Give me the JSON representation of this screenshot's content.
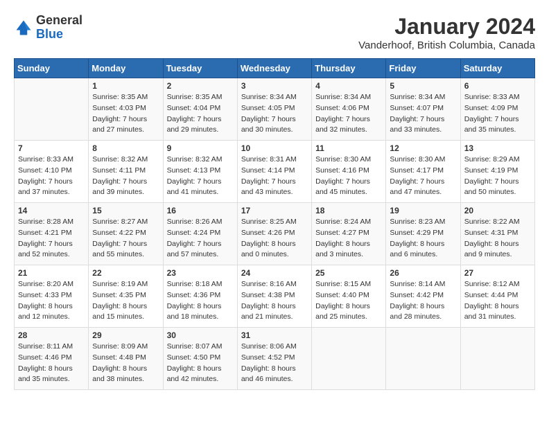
{
  "logo": {
    "general": "General",
    "blue": "Blue"
  },
  "title": "January 2024",
  "subtitle": "Vanderhoof, British Columbia, Canada",
  "headers": [
    "Sunday",
    "Monday",
    "Tuesday",
    "Wednesday",
    "Thursday",
    "Friday",
    "Saturday"
  ],
  "weeks": [
    [
      {
        "num": "",
        "sunrise": "",
        "sunset": "",
        "daylight": ""
      },
      {
        "num": "1",
        "sunrise": "Sunrise: 8:35 AM",
        "sunset": "Sunset: 4:03 PM",
        "daylight": "Daylight: 7 hours and 27 minutes."
      },
      {
        "num": "2",
        "sunrise": "Sunrise: 8:35 AM",
        "sunset": "Sunset: 4:04 PM",
        "daylight": "Daylight: 7 hours and 29 minutes."
      },
      {
        "num": "3",
        "sunrise": "Sunrise: 8:34 AM",
        "sunset": "Sunset: 4:05 PM",
        "daylight": "Daylight: 7 hours and 30 minutes."
      },
      {
        "num": "4",
        "sunrise": "Sunrise: 8:34 AM",
        "sunset": "Sunset: 4:06 PM",
        "daylight": "Daylight: 7 hours and 32 minutes."
      },
      {
        "num": "5",
        "sunrise": "Sunrise: 8:34 AM",
        "sunset": "Sunset: 4:07 PM",
        "daylight": "Daylight: 7 hours and 33 minutes."
      },
      {
        "num": "6",
        "sunrise": "Sunrise: 8:33 AM",
        "sunset": "Sunset: 4:09 PM",
        "daylight": "Daylight: 7 hours and 35 minutes."
      }
    ],
    [
      {
        "num": "7",
        "sunrise": "Sunrise: 8:33 AM",
        "sunset": "Sunset: 4:10 PM",
        "daylight": "Daylight: 7 hours and 37 minutes."
      },
      {
        "num": "8",
        "sunrise": "Sunrise: 8:32 AM",
        "sunset": "Sunset: 4:11 PM",
        "daylight": "Daylight: 7 hours and 39 minutes."
      },
      {
        "num": "9",
        "sunrise": "Sunrise: 8:32 AM",
        "sunset": "Sunset: 4:13 PM",
        "daylight": "Daylight: 7 hours and 41 minutes."
      },
      {
        "num": "10",
        "sunrise": "Sunrise: 8:31 AM",
        "sunset": "Sunset: 4:14 PM",
        "daylight": "Daylight: 7 hours and 43 minutes."
      },
      {
        "num": "11",
        "sunrise": "Sunrise: 8:30 AM",
        "sunset": "Sunset: 4:16 PM",
        "daylight": "Daylight: 7 hours and 45 minutes."
      },
      {
        "num": "12",
        "sunrise": "Sunrise: 8:30 AM",
        "sunset": "Sunset: 4:17 PM",
        "daylight": "Daylight: 7 hours and 47 minutes."
      },
      {
        "num": "13",
        "sunrise": "Sunrise: 8:29 AM",
        "sunset": "Sunset: 4:19 PM",
        "daylight": "Daylight: 7 hours and 50 minutes."
      }
    ],
    [
      {
        "num": "14",
        "sunrise": "Sunrise: 8:28 AM",
        "sunset": "Sunset: 4:21 PM",
        "daylight": "Daylight: 7 hours and 52 minutes."
      },
      {
        "num": "15",
        "sunrise": "Sunrise: 8:27 AM",
        "sunset": "Sunset: 4:22 PM",
        "daylight": "Daylight: 7 hours and 55 minutes."
      },
      {
        "num": "16",
        "sunrise": "Sunrise: 8:26 AM",
        "sunset": "Sunset: 4:24 PM",
        "daylight": "Daylight: 7 hours and 57 minutes."
      },
      {
        "num": "17",
        "sunrise": "Sunrise: 8:25 AM",
        "sunset": "Sunset: 4:26 PM",
        "daylight": "Daylight: 8 hours and 0 minutes."
      },
      {
        "num": "18",
        "sunrise": "Sunrise: 8:24 AM",
        "sunset": "Sunset: 4:27 PM",
        "daylight": "Daylight: 8 hours and 3 minutes."
      },
      {
        "num": "19",
        "sunrise": "Sunrise: 8:23 AM",
        "sunset": "Sunset: 4:29 PM",
        "daylight": "Daylight: 8 hours and 6 minutes."
      },
      {
        "num": "20",
        "sunrise": "Sunrise: 8:22 AM",
        "sunset": "Sunset: 4:31 PM",
        "daylight": "Daylight: 8 hours and 9 minutes."
      }
    ],
    [
      {
        "num": "21",
        "sunrise": "Sunrise: 8:20 AM",
        "sunset": "Sunset: 4:33 PM",
        "daylight": "Daylight: 8 hours and 12 minutes."
      },
      {
        "num": "22",
        "sunrise": "Sunrise: 8:19 AM",
        "sunset": "Sunset: 4:35 PM",
        "daylight": "Daylight: 8 hours and 15 minutes."
      },
      {
        "num": "23",
        "sunrise": "Sunrise: 8:18 AM",
        "sunset": "Sunset: 4:36 PM",
        "daylight": "Daylight: 8 hours and 18 minutes."
      },
      {
        "num": "24",
        "sunrise": "Sunrise: 8:16 AM",
        "sunset": "Sunset: 4:38 PM",
        "daylight": "Daylight: 8 hours and 21 minutes."
      },
      {
        "num": "25",
        "sunrise": "Sunrise: 8:15 AM",
        "sunset": "Sunset: 4:40 PM",
        "daylight": "Daylight: 8 hours and 25 minutes."
      },
      {
        "num": "26",
        "sunrise": "Sunrise: 8:14 AM",
        "sunset": "Sunset: 4:42 PM",
        "daylight": "Daylight: 8 hours and 28 minutes."
      },
      {
        "num": "27",
        "sunrise": "Sunrise: 8:12 AM",
        "sunset": "Sunset: 4:44 PM",
        "daylight": "Daylight: 8 hours and 31 minutes."
      }
    ],
    [
      {
        "num": "28",
        "sunrise": "Sunrise: 8:11 AM",
        "sunset": "Sunset: 4:46 PM",
        "daylight": "Daylight: 8 hours and 35 minutes."
      },
      {
        "num": "29",
        "sunrise": "Sunrise: 8:09 AM",
        "sunset": "Sunset: 4:48 PM",
        "daylight": "Daylight: 8 hours and 38 minutes."
      },
      {
        "num": "30",
        "sunrise": "Sunrise: 8:07 AM",
        "sunset": "Sunset: 4:50 PM",
        "daylight": "Daylight: 8 hours and 42 minutes."
      },
      {
        "num": "31",
        "sunrise": "Sunrise: 8:06 AM",
        "sunset": "Sunset: 4:52 PM",
        "daylight": "Daylight: 8 hours and 46 minutes."
      },
      {
        "num": "",
        "sunrise": "",
        "sunset": "",
        "daylight": ""
      },
      {
        "num": "",
        "sunrise": "",
        "sunset": "",
        "daylight": ""
      },
      {
        "num": "",
        "sunrise": "",
        "sunset": "",
        "daylight": ""
      }
    ]
  ]
}
